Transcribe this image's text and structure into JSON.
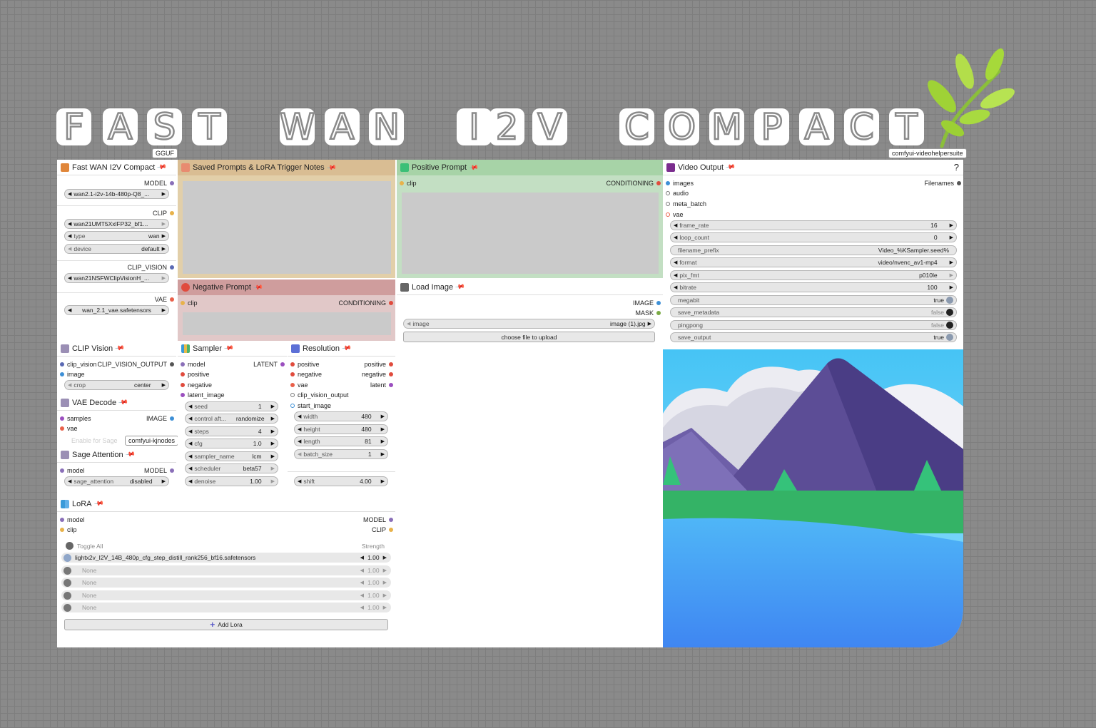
{
  "title_letters": [
    "F",
    "A",
    "S",
    "T",
    "W",
    "A",
    "N",
    "I",
    "2",
    "V",
    "C",
    "O",
    "M",
    "P",
    "A",
    "C",
    "T"
  ],
  "tags": {
    "gguf": "GGUF",
    "vhs": "comfyui-videohelpersuite",
    "kjnodes": "comfyui-kjnodes"
  },
  "colors": {
    "model": "#8a6fb8",
    "clip": "#e8b24a",
    "clip_vision": "#5a69b3",
    "vae": "#e9604a",
    "conditioning": "#e04b3d",
    "latent": "#9b4fbf",
    "image": "#3d8fd6",
    "mask": "#7aaa44",
    "filenames": "#555555",
    "pin": "#d0336b"
  },
  "loader": {
    "title": "Fast WAN I2V Compact",
    "model_out": "MODEL",
    "unet_name": "wan2.1-i2v-14b-480p-Q8_...",
    "clip_out": "CLIP",
    "clip_name": "wan21UMT5XxlFP32_bf1...",
    "type_label": "type",
    "type_value": "wan",
    "device_label": "device",
    "device_value": "default",
    "clip_vision_out": "CLIP_VISION",
    "clip_vision_name": "wan21NSFWClipVisionH_...",
    "vae_out": "VAE",
    "vae_name": "wan_2.1_vae.safetensors"
  },
  "notes": {
    "title": "Saved Prompts & LoRA Trigger Notes"
  },
  "negative": {
    "title": "Negative Prompt",
    "in": "clip",
    "out": "CONDITIONING"
  },
  "positive": {
    "title": "Positive Prompt",
    "in": "clip",
    "out": "CONDITIONING"
  },
  "load_image": {
    "title": "Load Image",
    "out_image": "IMAGE",
    "out_mask": "MASK",
    "image_label": "image",
    "image_value": "image (1).jpg",
    "upload": "choose file to upload"
  },
  "video_output": {
    "title": "Video Output",
    "help": "?",
    "inputs": [
      "images",
      "audio",
      "meta_batch",
      "vae"
    ],
    "out": "Filenames",
    "widgets": [
      {
        "label": "frame_rate",
        "value": "16"
      },
      {
        "label": "loop_count",
        "value": "0"
      },
      {
        "label": "filename_prefix",
        "value": "Video_%KSampler.seed%"
      },
      {
        "label": "format",
        "value": "video/nvenc_av1-mp4"
      },
      {
        "label": "pix_fmt",
        "value": "p010le"
      },
      {
        "label": "bitrate",
        "value": "100"
      },
      {
        "label": "megabit",
        "value": "true"
      },
      {
        "label": "save_metadata",
        "value": "false"
      },
      {
        "label": "pingpong",
        "value": "false"
      },
      {
        "label": "save_output",
        "value": "true"
      }
    ]
  },
  "clip_vision_node": {
    "title": "CLIP Vision",
    "in1": "clip_vision",
    "in2": "image",
    "out": "CLIP_VISION_OUTPUT",
    "crop_label": "crop",
    "crop_value": "center"
  },
  "vae_decode": {
    "title": "VAE Decode",
    "in1": "samples",
    "in2": "vae",
    "out": "IMAGE"
  },
  "hidden_text": "Enable for Sage",
  "sage": {
    "title": "Sage Attention",
    "in": "model",
    "out": "MODEL",
    "label": "sage_attention",
    "value": "disabled"
  },
  "sampler": {
    "title": "Sampler",
    "inputs": [
      "model",
      "positive",
      "negative",
      "latent_image"
    ],
    "out": "LATENT",
    "widgets": [
      {
        "label": "seed",
        "value": "1"
      },
      {
        "label": "control aft...",
        "value": "randomize"
      },
      {
        "label": "steps",
        "value": "4"
      },
      {
        "label": "cfg",
        "value": "1.0"
      },
      {
        "label": "sampler_name",
        "value": "lcm"
      },
      {
        "label": "scheduler",
        "value": "beta57"
      },
      {
        "label": "denoise",
        "value": "1.00"
      }
    ]
  },
  "resolution": {
    "title": "Resolution",
    "inputs": [
      "positive",
      "negative",
      "vae",
      "clip_vision_output",
      "start_image"
    ],
    "outputs": [
      "positive",
      "negative",
      "latent"
    ],
    "widgets": [
      {
        "label": "width",
        "value": "480"
      },
      {
        "label": "height",
        "value": "480"
      },
      {
        "label": "length",
        "value": "81"
      },
      {
        "label": "batch_size",
        "value": "1"
      }
    ],
    "shift_label": "shift",
    "shift_value": "4.00"
  },
  "lora": {
    "title": "LoRA",
    "in1": "model",
    "in2": "clip",
    "out1": "MODEL",
    "out2": "CLIP",
    "toggle_all": "Toggle All",
    "strength_header": "Strength",
    "rows": [
      {
        "name": "lightx2v_I2V_14B_480p_cfg_step_distill_rank256_bf16.safetensors",
        "strength": "1.00",
        "on": true
      },
      {
        "name": "None",
        "strength": "1.00",
        "on": false
      },
      {
        "name": "None",
        "strength": "1.00",
        "on": false
      },
      {
        "name": "None",
        "strength": "1.00",
        "on": false
      },
      {
        "name": "None",
        "strength": "1.00",
        "on": false
      }
    ],
    "add": "Add Lora"
  }
}
